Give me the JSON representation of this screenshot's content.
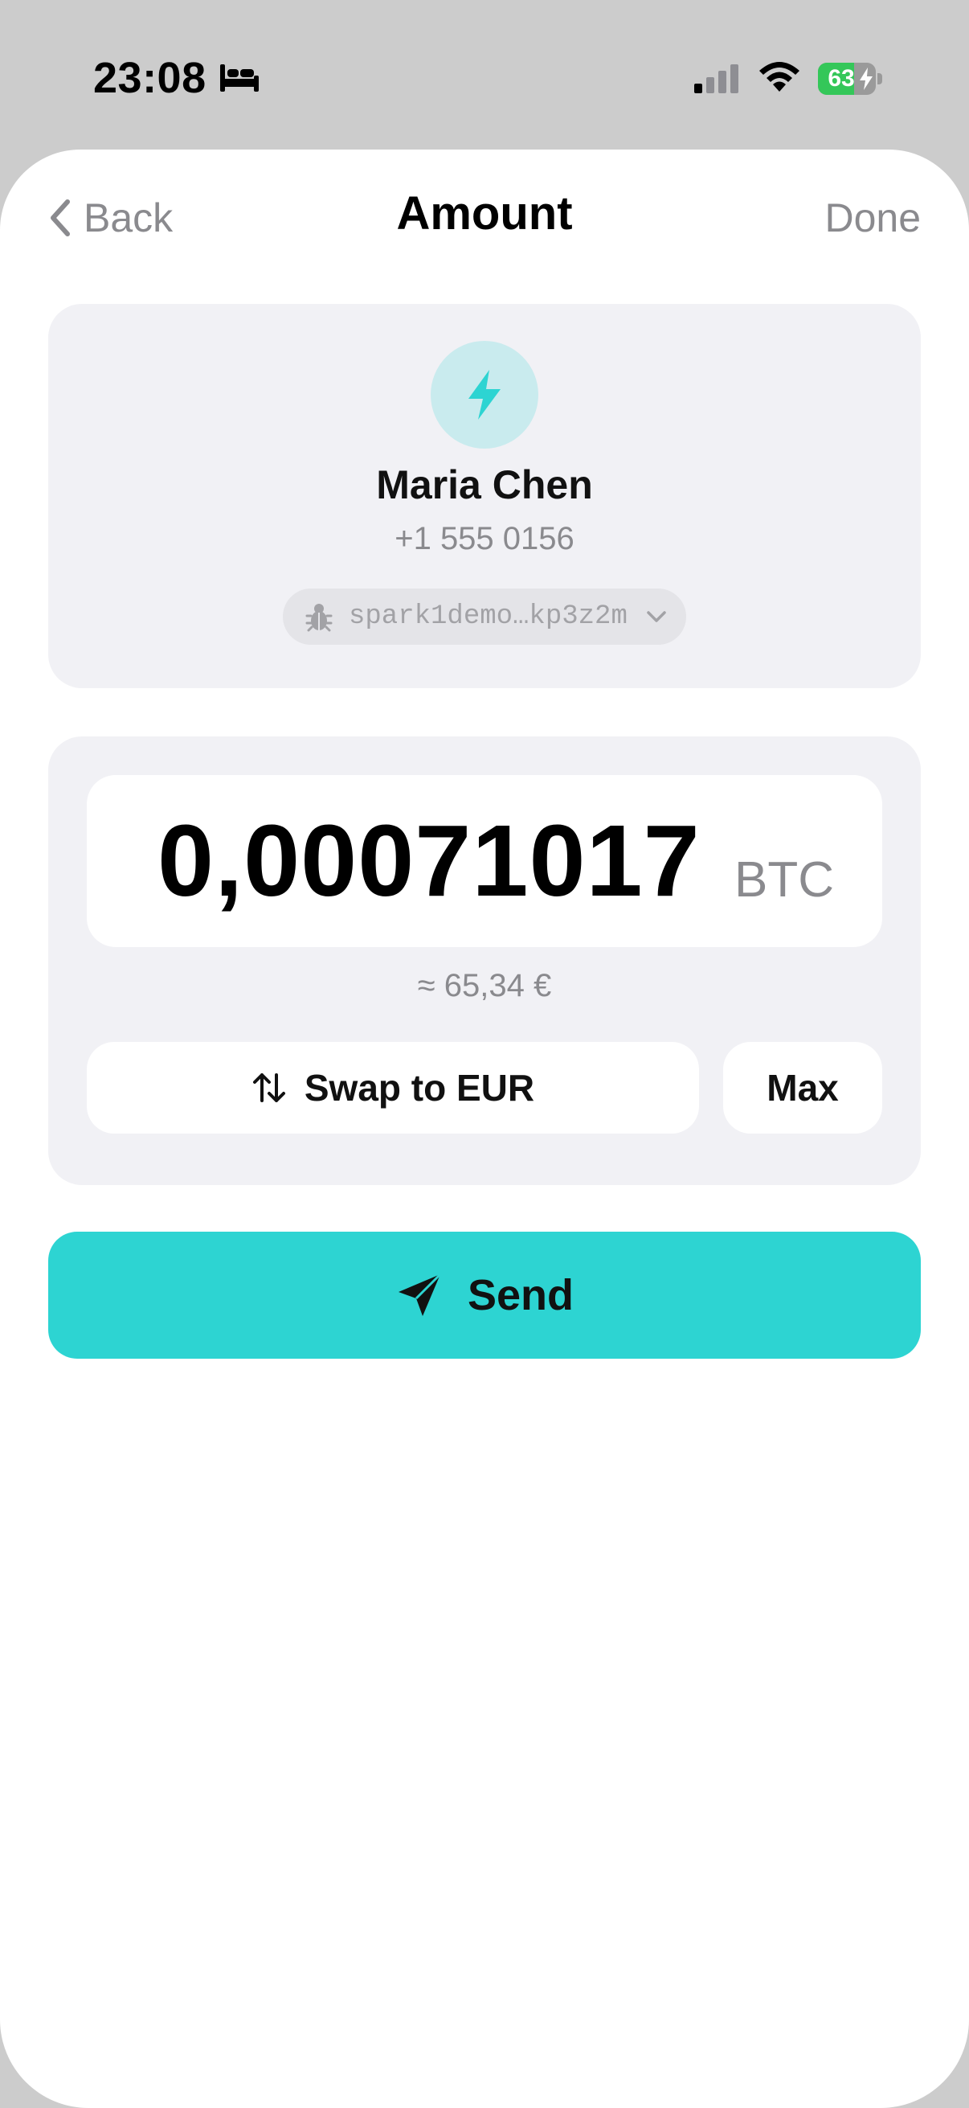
{
  "status_bar": {
    "time": "23:08",
    "battery_percent": "63",
    "battery_level": 0.63,
    "icons": [
      "bed-icon",
      "cellular-signal-icon",
      "wifi-icon",
      "battery-charging-icon"
    ]
  },
  "nav": {
    "back_label": "Back",
    "title": "Amount",
    "done_label": "Done"
  },
  "recipient": {
    "avatar_icon": "lightning-bolt-icon",
    "name": "Maria Chen",
    "phone": "+1 555 0156",
    "address": "spark1demo…kp3z2m",
    "address_icon": "bug-icon"
  },
  "amount": {
    "value": "0,00071017",
    "unit": "BTC",
    "fiat_approx": "≈ 65,34 €",
    "swap_label": "Swap to EUR",
    "max_label": "Max"
  },
  "send": {
    "label": "Send",
    "icon": "paper-plane-icon"
  },
  "colors": {
    "accent": "#2dd4d2",
    "avatar_bg": "#c9ebee",
    "card_bg": "#f1f1f5",
    "muted_text": "#8a8a8e",
    "battery_green": "#34c759"
  }
}
